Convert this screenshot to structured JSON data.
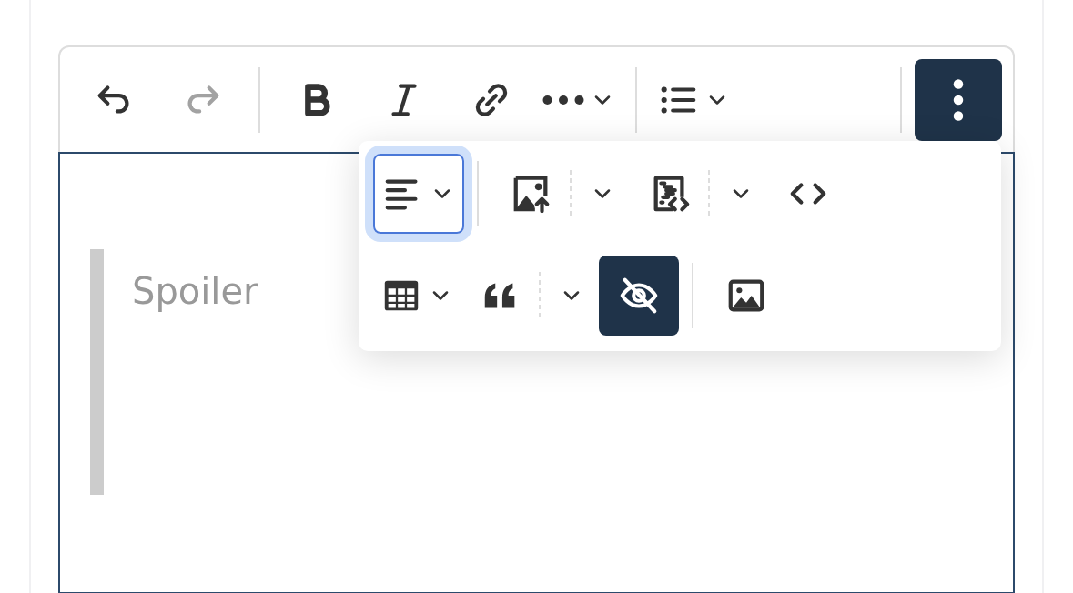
{
  "toolbar": {
    "groups": [
      {
        "buttons": [
          {
            "kind": "undo",
            "dropdown": false,
            "split": false,
            "disabled": false,
            "active": false,
            "focused": false
          },
          {
            "kind": "redo",
            "dropdown": false,
            "split": false,
            "disabled": true,
            "active": false,
            "focused": false
          }
        ]
      },
      {
        "buttons": [
          {
            "kind": "bold",
            "dropdown": false,
            "split": false,
            "disabled": false,
            "active": false,
            "focused": false
          },
          {
            "kind": "italic",
            "dropdown": false,
            "split": false,
            "disabled": false,
            "active": false,
            "focused": false
          },
          {
            "kind": "link",
            "dropdown": false,
            "split": false,
            "disabled": false,
            "active": false,
            "focused": false
          },
          {
            "kind": "more-formatting",
            "dropdown": true,
            "split": false,
            "disabled": false,
            "active": false,
            "focused": false
          }
        ]
      },
      {
        "buttons": [
          {
            "kind": "list",
            "dropdown": true,
            "split": false,
            "disabled": false,
            "active": false,
            "focused": false
          }
        ]
      },
      {
        "buttons": [
          {
            "kind": "more-items",
            "dropdown": false,
            "split": false,
            "disabled": false,
            "active": true,
            "focused": false
          }
        ]
      }
    ]
  },
  "overflow_menu": {
    "rows": [
      {
        "groups": [
          {
            "buttons": [
              {
                "kind": "align",
                "dropdown": true,
                "split": false,
                "disabled": false,
                "active": false,
                "focused": true
              }
            ]
          },
          {
            "buttons": [
              {
                "kind": "image-upload",
                "dropdown": true,
                "split": true,
                "disabled": false,
                "active": false,
                "focused": false
              },
              {
                "kind": "code-block",
                "dropdown": true,
                "split": true,
                "disabled": false,
                "active": false,
                "focused": false
              },
              {
                "kind": "code",
                "dropdown": false,
                "split": false,
                "disabled": false,
                "active": false,
                "focused": false
              }
            ]
          }
        ]
      },
      {
        "groups": [
          {
            "buttons": [
              {
                "kind": "table",
                "dropdown": true,
                "split": false,
                "disabled": false,
                "active": false,
                "focused": false
              },
              {
                "kind": "quote",
                "dropdown": true,
                "split": true,
                "disabled": false,
                "active": false,
                "focused": false
              },
              {
                "kind": "spoiler",
                "dropdown": false,
                "split": false,
                "disabled": false,
                "active": true,
                "focused": false
              }
            ]
          },
          {
            "buttons": [
              {
                "kind": "image",
                "dropdown": false,
                "split": false,
                "disabled": false,
                "active": false,
                "focused": false
              }
            ]
          }
        ]
      }
    ]
  },
  "spoiler_block": {
    "placeholder": "Spoiler"
  }
}
